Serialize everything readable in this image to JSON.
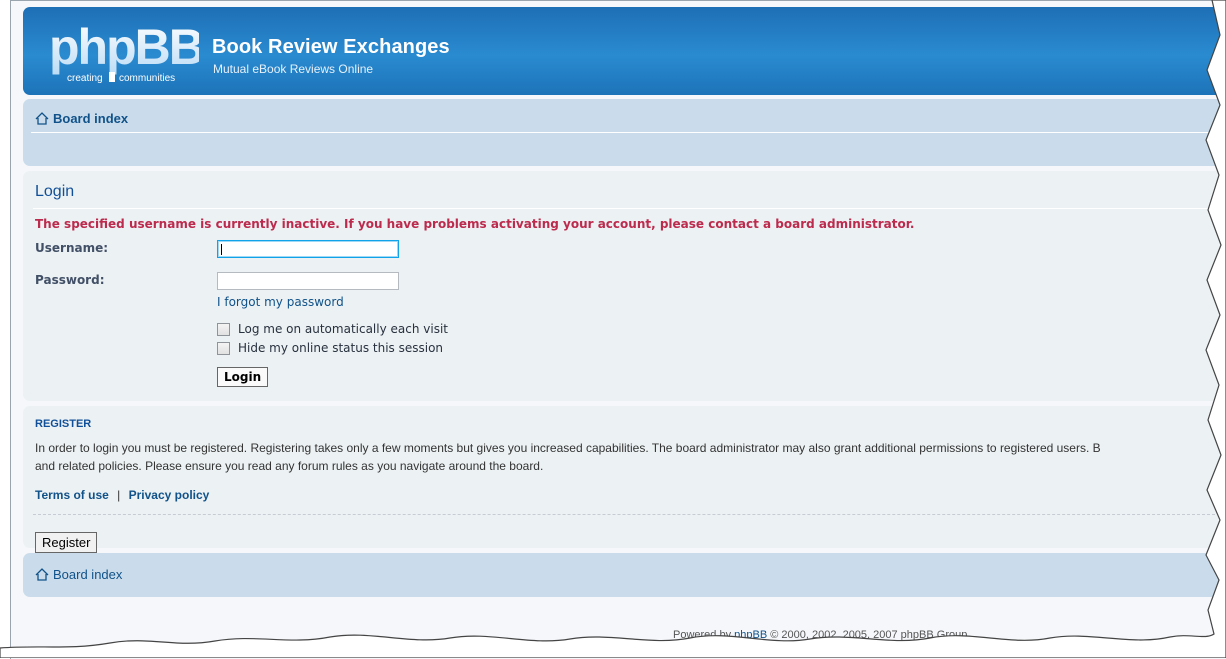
{
  "header": {
    "logo_text": "phpBB",
    "logo_tagline": "creating communities",
    "site_title": "Book Review Exchanges",
    "site_description": "Mutual eBook Reviews Online"
  },
  "navbar": {
    "breadcrumb": "Board index"
  },
  "login": {
    "title": "Login",
    "error": "The specified username is currently inactive. If you have problems activating your account, please contact a board administrator.",
    "username_label": "Username:",
    "username_value": "",
    "password_label": "Password:",
    "password_value": "",
    "forgot_link": "I forgot my password",
    "autologin_label": "Log me on automatically each visit",
    "hide_status_label": "Hide my online status this session",
    "submit_label": "Login"
  },
  "register": {
    "heading": "REGISTER",
    "text_line1": "In order to login you must be registered. Registering takes only a few moments but gives you increased capabilities. The board administrator may also grant additional permissions to registered users. B",
    "text_line2": "and related policies. Please ensure you read any forum rules as you navigate around the board.",
    "terms_link": "Terms of use",
    "separator": "|",
    "privacy_link": "Privacy policy",
    "button_label": "Register"
  },
  "footer": {
    "breadcrumb": "Board index",
    "powered_prefix": "Powered by ",
    "powered_link": "phpBB",
    "copyright": " © 2000, 2002, 2005, 2007 phpBB Group"
  },
  "colors": {
    "header_blue": "#1e6fb5",
    "nav_bg": "#cadceb",
    "panel_bg": "#ecf1f3",
    "error_red": "#bc2a4d",
    "link_blue": "#105289"
  }
}
